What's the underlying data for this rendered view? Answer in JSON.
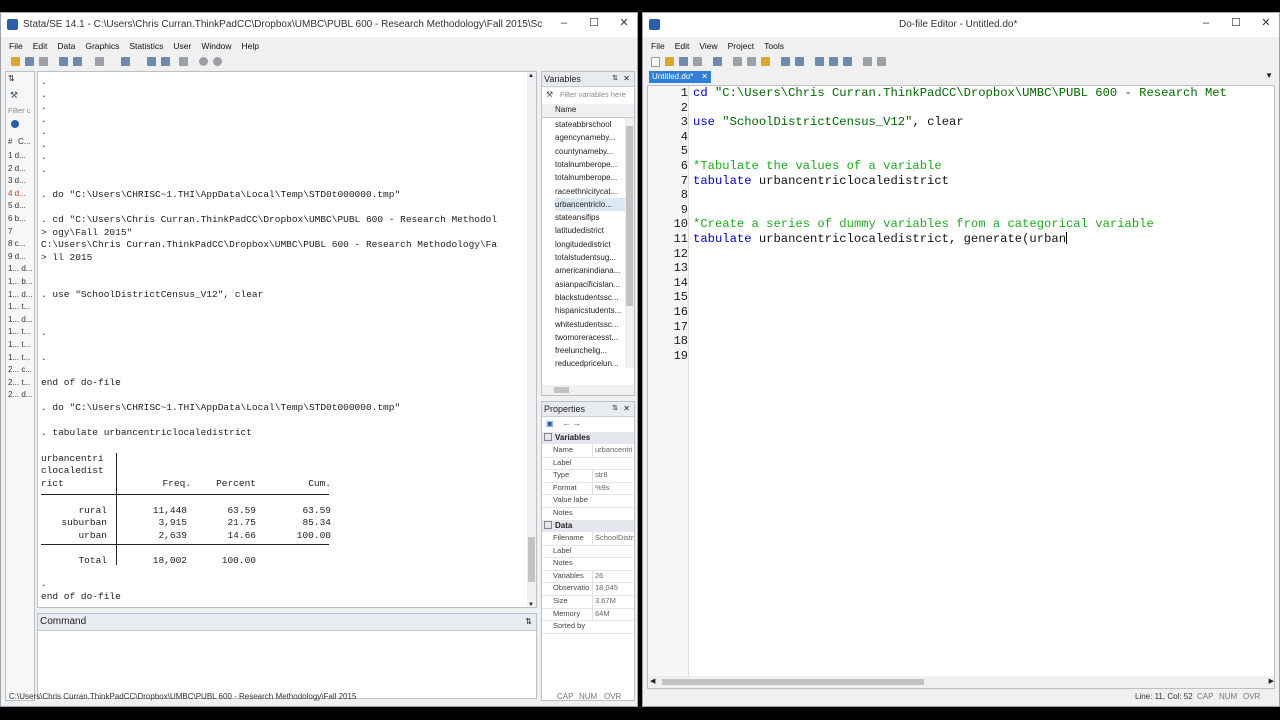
{
  "stata": {
    "title": "Stata/SE 14.1 - C:\\Users\\Chris Curran.ThinkPadCC\\Dropbox\\UMBC\\PUBL 600 - Research Methodology\\Fall 2015\\SchoolDist...",
    "menu": [
      "File",
      "Edit",
      "Data",
      "Graphics",
      "Statistics",
      "User",
      "Window",
      "Help"
    ],
    "history": {
      "filter_placeholder": "Filter c",
      "col_num": "#",
      "col_cmd": "C...",
      "items": [
        "1 d...",
        "2 d...",
        "3 d...",
        "4 d...",
        "5 d...",
        "6 b...",
        "7",
        "8 c...",
        "9 d...",
        "1... d...",
        "1... b...",
        "1... d...",
        "1... t...",
        "1... d...",
        "1... t...",
        "1... t...",
        "1... t...",
        "2... c...",
        "2... t...",
        "2... d..."
      ]
    },
    "results": {
      "lines": [
        ".",
        ".",
        ".",
        ".",
        ".",
        ".",
        ".",
        ".",
        "",
        ". do \"C:\\Users\\CHRISC~1.THI\\AppData\\Local\\Temp\\STD0t000000.tmp\"",
        "",
        ". cd \"C:\\Users\\Chris Curran.ThinkPadCC\\Dropbox\\UMBC\\PUBL 600 - Research Methodol",
        "> ogy\\Fall 2015\"",
        "C:\\Users\\Chris Curran.ThinkPadCC\\Dropbox\\UMBC\\PUBL 600 - Research Methodology\\Fa",
        "> ll 2015",
        "",
        "",
        ". use \"SchoolDistrictCensus_V12\", clear",
        "",
        "",
        ".",
        "",
        ".",
        "",
        "end of do-file",
        "",
        ". do \"C:\\Users\\CHRISC~1.THI\\AppData\\Local\\Temp\\STD0t000000.tmp\"",
        "",
        ". tabulate urbancentriclocaledistrict",
        ""
      ],
      "table": {
        "header_lines": [
          "urbancentri",
          "clocaledist",
          "rict"
        ],
        "cols": [
          "Freq.",
          "Percent",
          "Cum."
        ],
        "rows": [
          {
            "label": "rural",
            "freq": "11,448",
            "pct": "63.59",
            "cum": "63.59"
          },
          {
            "label": "suburban",
            "freq": "3,915",
            "pct": "21.75",
            "cum": "85.34"
          },
          {
            "label": "urban",
            "freq": "2,639",
            "pct": "14.66",
            "cum": "100.00"
          }
        ],
        "total_label": "Total",
        "total_freq": "18,002",
        "total_pct": "100.00"
      },
      "after": [
        ".",
        "end of do-file",
        "",
        "."
      ]
    },
    "command_label": "Command",
    "variables": {
      "title": "Variables",
      "filter_placeholder": "Filter variables here",
      "col_name": "Name",
      "items": [
        "stateabbrschool",
        "agencynameby...",
        "countynameby...",
        "totalnumberope...",
        "totalnumberope...",
        "raceethnicitycat...",
        "urbancentriclo...",
        "stateansifips",
        "latitudedistrict",
        "longitudedistrict",
        "totalstudentsug...",
        "americanindiana...",
        "asianpacificislan...",
        "blackstudentssc...",
        "hispanicstudents...",
        "whitestudentssc...",
        "twomoreracesst...",
        "freelunchelig...",
        "reducedpricelun..."
      ]
    },
    "properties": {
      "title": "Properties",
      "var_section": "Variables",
      "var_rows": [
        {
          "k": "Name",
          "v": "urbancentri"
        },
        {
          "k": "Label",
          "v": ""
        },
        {
          "k": "Type",
          "v": "str8"
        },
        {
          "k": "Format",
          "v": "%9s"
        },
        {
          "k": "Value labe",
          "v": ""
        },
        {
          "k": "Notes",
          "v": ""
        }
      ],
      "data_section": "Data",
      "data_rows": [
        {
          "k": "Filename",
          "v": "SchoolDistri"
        },
        {
          "k": "Label",
          "v": ""
        },
        {
          "k": "Notes",
          "v": ""
        },
        {
          "k": "Variables",
          "v": "26"
        },
        {
          "k": "Observatio",
          "v": "18,045"
        },
        {
          "k": "Size",
          "v": "3.67M"
        },
        {
          "k": "Memory",
          "v": "64M"
        },
        {
          "k": "Sorted by",
          "v": ""
        }
      ]
    },
    "status": {
      "path": "C:\\Users\\Chris Curran.ThinkPadCC\\Dropbox\\UMBC\\PUBL 600 - Research Methodology\\Fall 2015",
      "cap": "CAP",
      "num": "NUM",
      "ovr": "OVR"
    }
  },
  "dofile": {
    "title": "Do-file Editor - Untitled.do*",
    "menu": [
      "File",
      "Edit",
      "View",
      "Project",
      "Tools"
    ],
    "tab_label": "Untitled.do*",
    "line_numbers": [
      "1",
      "2",
      "3",
      "4",
      "5",
      "6",
      "7",
      "8",
      "9",
      "10",
      "11",
      "12",
      "13",
      "14",
      "15",
      "16",
      "17",
      "18",
      "19"
    ],
    "code": {
      "l1_cmd": "cd",
      "l1_str": " \"C:\\Users\\Chris Curran.ThinkPadCC\\Dropbox\\UMBC\\PUBL 600 - Research Met",
      "l3_cmd": "use",
      "l3_str": " \"SchoolDistrictCensus_V12\"",
      "l3_rest": ", clear",
      "l6_comment": "*Tabulate the values of a variable",
      "l7_cmd": "tabulate",
      "l7_rest": " urbancentriclocaledistrict",
      "l10_comment": "*Create a series of dummy variables from a categorical variable",
      "l11_cmd": "tabulate",
      "l11_rest": " urbancentriclocaledistrict, generate(urban"
    },
    "status": {
      "pos": "Line: 11, Col: 52",
      "cap": "CAP",
      "num": "NUM",
      "ovr": "OVR"
    }
  }
}
